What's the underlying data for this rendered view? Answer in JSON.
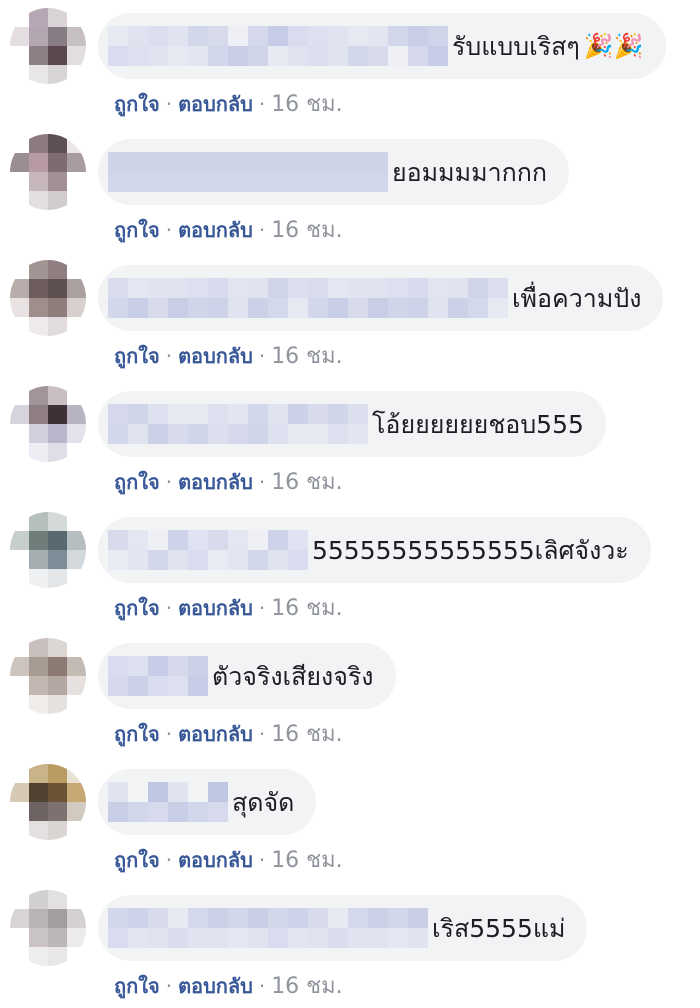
{
  "comments": [
    {
      "text": "รับแบบเริสๆ",
      "emoji": "🎉🎉",
      "like_label": "ถูกใจ",
      "reply_label": "ตอบกลับ",
      "time": "16 ชม.",
      "separator": "·",
      "name_blur_cols": 17,
      "avatar_colors": [
        "#fff",
        "#b8a8b5",
        "#d9d3d8",
        "#fff",
        "#e4dde2",
        "#b3a7b2",
        "#877b84",
        "#c7c0c3",
        "#fff",
        "#8e7f85",
        "#5a4750",
        "#e1dde0",
        "#fff",
        "#e9e6e9",
        "#d7d3d6",
        "#fff"
      ],
      "blur_colors": [
        "#e7e9f3",
        "#dfe2ef",
        "#d6daeb",
        "#cfd4e8",
        "#dde0ee",
        "#d3d7ea",
        "#c9cee6",
        "#d9dcee",
        "#e0e3f0",
        "#d2d6ea",
        "#c6cce5",
        "#dadeee",
        "#e3e5f1",
        "#d5d9eb",
        "#dfe2ef",
        "#e6e8f2",
        "#eef0f6"
      ]
    },
    {
      "text": "ยอมมมมากกก",
      "emoji": "",
      "like_label": "ถูกใจ",
      "reply_label": "ตอบกลับ",
      "time": "16 ชม.",
      "separator": "·",
      "name_blur_cols": 14,
      "avatar_colors": [
        "#fff",
        "#8c7a82",
        "#5e4e56",
        "#e9e5e8",
        "#9b8d94",
        "#b79aa5",
        "#7d6a73",
        "#a89ca2",
        "#fff",
        "#c8b6bd",
        "#a38f97",
        "#fff",
        "#fff",
        "#e3dee1",
        "#d1cace",
        "#fff"
      ],
      "blur_colors": [
        "#e2e4f0",
        "#d9ddee",
        "#dfe2f0",
        "#ced3e8",
        "#e5e7f2",
        "#d4d8eb",
        "#dcdfef",
        "#c9cfe7",
        "#d8dbed",
        "#e0e3f0",
        "#d2d6ea",
        "#dde0ef",
        "#e7e9f3",
        "#edeff6"
      ]
    },
    {
      "text": "เพื่อความปัง",
      "emoji": "",
      "like_label": "ถูกใจ",
      "reply_label": "ตอบกลับ",
      "time": "16 ชม.",
      "separator": "·",
      "name_blur_cols": 20,
      "avatar_colors": [
        "#fff",
        "#a19493",
        "#8f7f80",
        "#fff",
        "#b9adab",
        "#6e5d5d",
        "#5e4f50",
        "#a9a09f",
        "#e8e2e2",
        "#9e8e8c",
        "#8d7d7b",
        "#d7d0cf",
        "#fff",
        "#eeeaea",
        "#e1dbdb",
        "#fff"
      ],
      "blur_colors": [
        "#e4e6f1",
        "#d6daeb",
        "#dde0ef",
        "#cdd2e8",
        "#e1e4f0",
        "#d4d8eb",
        "#d9dced",
        "#c8cee6",
        "#dfe2ef",
        "#d1d5ea",
        "#e2e5f1",
        "#ccd1e7",
        "#dbdeee",
        "#d3d7ea",
        "#e0e3f0",
        "#c9cee6",
        "#d8dbed",
        "#dfe2ef",
        "#cfd4e9",
        "#e6e8f2"
      ]
    },
    {
      "text": "โอ้ยยยยยยชอบ555",
      "emoji": "",
      "like_label": "ถูกใจ",
      "reply_label": "ตอบกลับ",
      "time": "16 ชม.",
      "separator": "·",
      "name_blur_cols": 13,
      "avatar_colors": [
        "#fff",
        "#a2949a",
        "#c9bec3",
        "#fff",
        "#d6d3dd",
        "#8f7d86",
        "#3f2f36",
        "#b8b3c2",
        "#fff",
        "#d3cedb",
        "#b9b6cb",
        "#e3e1ea",
        "#fff",
        "#eeedf3",
        "#e0dde6",
        "#fff"
      ],
      "blur_colors": [
        "#e8eaf3",
        "#dde0ef",
        "#e3e5f1",
        "#d3d7ea",
        "#dfe2ef",
        "#ccd1e7",
        "#d7dbec",
        "#d0d5e9",
        "#dcdfee",
        "#d5d9eb",
        "#d0d4e9",
        "#dee1ef",
        "#e7e9f3"
      ]
    },
    {
      "text": "55555555555555เลิศจังวะ",
      "emoji": "",
      "like_label": "ถูกใจ",
      "reply_label": "ตอบกลับ",
      "time": "16 ชม.",
      "separator": "·",
      "name_blur_cols": 10,
      "avatar_colors": [
        "#fff",
        "#b5bfbb",
        "#d3dad7",
        "#fff",
        "#c6cfca",
        "#6f7e7a",
        "#5a6970",
        "#b7bec0",
        "#fff",
        "#a4aeb1",
        "#7d8c99",
        "#d3d8dd",
        "#fff",
        "#eef0f1",
        "#e3e6e8",
        "#fff"
      ],
      "blur_colors": [
        "#eef0f6",
        "#dfe2ef",
        "#d6daeb",
        "#e3e5f1",
        "#cdd2e8",
        "#d9dcee",
        "#e4e7f2",
        "#d3d7ea",
        "#dfe2f0",
        "#e9ebf4"
      ]
    },
    {
      "text": "ตัวจริงเสียงจริง",
      "emoji": "",
      "like_label": "ถูกใจ",
      "reply_label": "ตอบกลับ",
      "time": "16 ชม.",
      "separator": "·",
      "name_blur_cols": 5,
      "avatar_colors": [
        "#fff",
        "#c8c0bc",
        "#ddd7d4",
        "#fff",
        "#cdc4bf",
        "#a69a93",
        "#8b7b72",
        "#c4bab4",
        "#fff",
        "#c1b6b0",
        "#b3a7a1",
        "#e6e1de",
        "#fff",
        "#efecea",
        "#e5e1de",
        "#fff"
      ],
      "blur_colors": [
        "#d9dcee",
        "#ccd1e7",
        "#d5d9eb",
        "#c7cde6",
        "#dde0ef"
      ]
    },
    {
      "text": "สุดจัด",
      "emoji": "",
      "like_label": "ถูกใจ",
      "reply_label": "ตอบกลับ",
      "time": "16 ชม.",
      "separator": "·",
      "name_blur_cols": 6,
      "avatar_colors": [
        "#fff",
        "#c9b48a",
        "#b99b63",
        "#e9e1d1",
        "#d5c9b3",
        "#4f4231",
        "#6b5436",
        "#c7a874",
        "#fff",
        "#6d6363",
        "#7e7270",
        "#d2c9c0",
        "#fff",
        "#e4e0df",
        "#dad5d3",
        "#fff"
      ],
      "blur_colors": [
        "#e1e4f0",
        "#c9cee7",
        "#f2f3f5",
        "#d2d6ea",
        "#bfc6e2",
        "#d6daec"
      ]
    },
    {
      "text": "เริส5555แม่",
      "emoji": "",
      "like_label": "ถูกใจ",
      "reply_label": "ตอบกลับ",
      "time": "16 ชม.",
      "separator": "·",
      "name_blur_cols": 16,
      "avatar_colors": [
        "#fff",
        "#d1cfd1",
        "#e2e0e1",
        "#fff",
        "#d8d4d5",
        "#b9b3b5",
        "#a39d9f",
        "#d5d1d2",
        "#fff",
        "#c9c3c4",
        "#bdb6b8",
        "#eceaea",
        "#fff",
        "#eeeded",
        "#e8e6e6",
        "#fff"
      ],
      "blur_colors": [
        "#e4e6f1",
        "#d6daeb",
        "#dfe2ef",
        "#cdd2e8",
        "#e1e4f0",
        "#d3d7ea",
        "#dadded",
        "#c9cee6",
        "#dfe2ef",
        "#d2d6ea",
        "#e3e5f1",
        "#cbd0e7",
        "#d9dcee",
        "#d4d8eb",
        "#e0e3f0",
        "#e8eaf3"
      ]
    }
  ]
}
